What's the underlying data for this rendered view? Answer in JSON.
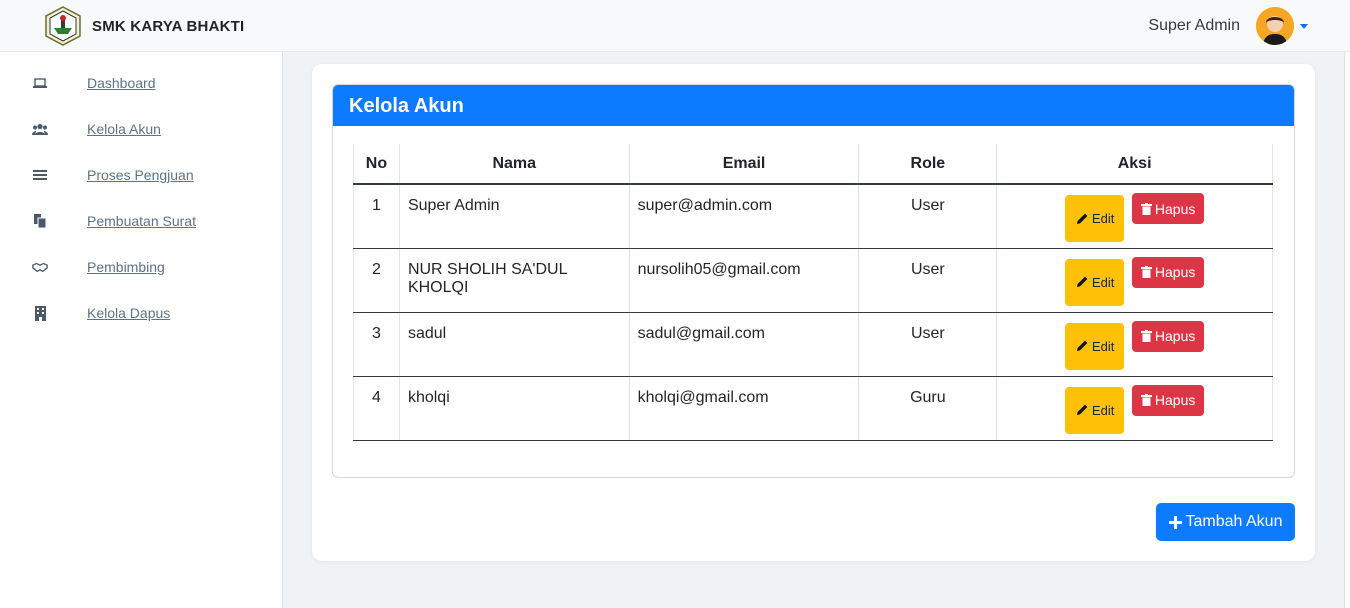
{
  "navbar": {
    "brand_name": "SMK KARYA BHAKTI",
    "user_name": "Super Admin"
  },
  "sidebar": {
    "items": [
      {
        "label": "Dashboard",
        "icon": "laptop-icon"
      },
      {
        "label": "Kelola Akun",
        "icon": "users-icon"
      },
      {
        "label": "Proses Pengjuan",
        "icon": "list-icon"
      },
      {
        "label": "Pembuatan Surat",
        "icon": "files-icon"
      },
      {
        "label": "Pembimbing",
        "icon": "handshake-icon"
      },
      {
        "label": "Kelola Dapus",
        "icon": "building-icon"
      }
    ]
  },
  "main": {
    "card_title": "Kelola Akun",
    "columns": [
      "No",
      "Nama",
      "Email",
      "Role",
      "Aksi"
    ],
    "rows": [
      {
        "no": "1",
        "nama": "Super Admin",
        "email": "super@admin.com",
        "role": "User"
      },
      {
        "no": "2",
        "nama": "NUR SHOLIH SA'DUL KHOLQI",
        "email": "nursolih05@gmail.com",
        "role": "User"
      },
      {
        "no": "3",
        "nama": "sadul",
        "email": "sadul@gmail.com",
        "role": "User"
      },
      {
        "no": "4",
        "nama": "kholqi",
        "email": "kholqi@gmail.com",
        "role": "Guru"
      }
    ],
    "edit_label": "Edit",
    "delete_label": "Hapus",
    "add_label": "Tambah Akun"
  },
  "colors": {
    "primary": "#0d7bff",
    "warning": "#ffc107",
    "danger": "#dc3545"
  }
}
